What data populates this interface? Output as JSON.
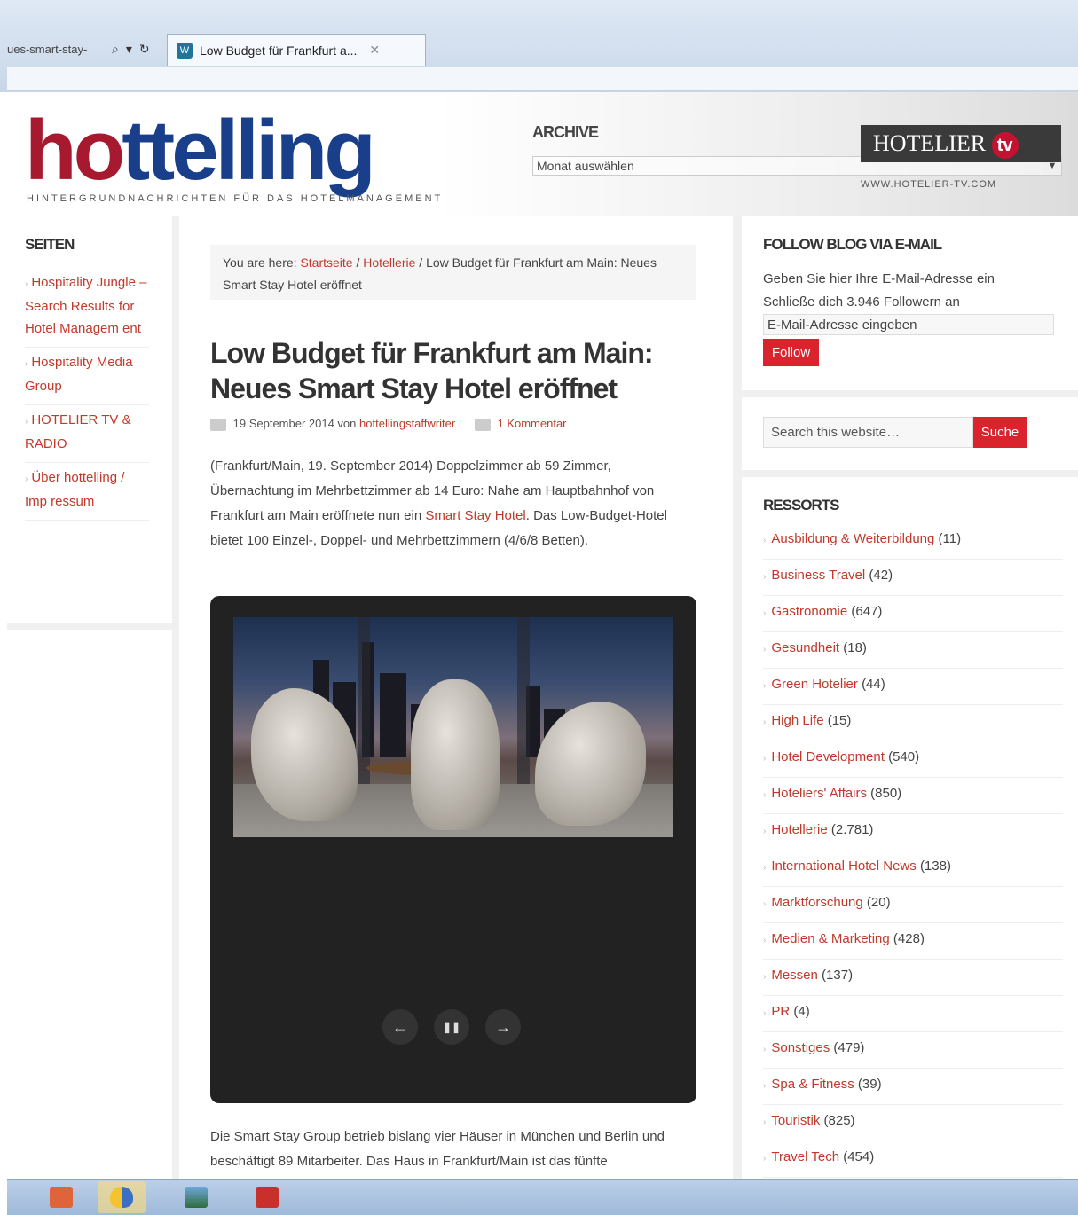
{
  "browser": {
    "address_fragment": "ues-smart-stay-",
    "tab_title": "Low Budget für Frankfurt a...",
    "favicon": "W"
  },
  "header": {
    "logo_part1": "ho",
    "logo_part2": "ttelling",
    "tagline": "HINTERGRUNDNACHRICHTEN FÜR DAS HOTELMANAGEMENT",
    "archive_label": "ARCHIVE",
    "archive_select_placeholder": "Monat auswählen",
    "ad_title": "HOTELIER",
    "ad_tv": "tv",
    "ad_url": "WWW.HOTELIER-TV.COM"
  },
  "left_sidebar": {
    "title": "SEITEN",
    "pages": [
      "Hospitality Jungle – Search Results for Hotel Managem ent",
      "Hospitality Media Group",
      "HOTELIER TV & RADIO",
      "Über hottelling / Imp ressum"
    ]
  },
  "content": {
    "breadcrumb_prefix": "You are here:",
    "crumb_home": "Startseite",
    "crumb_sep": "/",
    "crumb_category": "Hotellerie",
    "crumb_current": "/ Low Budget für Frankfurt am Main: Neues Smart Stay Hotel eröffnet",
    "title": "Low Budget für Frankfurt am Main: Neues Smart Stay Hotel eröffnet",
    "date": "19 September 2014 von",
    "author": "hottellingstaffwriter",
    "comments": "1 Kommentar",
    "intro_before": "(Frankfurt/Main, 19. September 2014) Doppelzimmer ab 59 Zimmer, Übernachtung im Mehrbettzimmer ab 14 Euro: Nahe am Hauptbahnhof von Frankfurt am Main eröffnete nun ein",
    "intro_link": "Smart Stay Hotel",
    "intro_after": ". Das Low-Budget-Hotel bietet 100 Einzel-, Doppel- und Mehrbettzimmern (4/6/8 Betten).",
    "slider_prev": "←",
    "slider_pause": "❚❚",
    "slider_next": "→",
    "para2": "Die Smart Stay Group betrieb bislang vier Häuser in München und Berlin und beschäftigt 89 Mitarbeiter. Das Haus in Frankfurt/Main ist das fünfte"
  },
  "right_sidebar": {
    "follow_title": "FOLLOW BLOG VIA E-MAIL",
    "follow_text": "Geben Sie hier Ihre E-Mail-Adresse ein Schließe dich 3.946 Followern an",
    "email_placeholder": "E-Mail-Adresse eingeben",
    "follow_button": "Follow",
    "search_placeholder": "Search this website…",
    "search_button": "Suche",
    "ressorts_title": "RESSORTS",
    "ressorts": [
      {
        "name": "Ausbildung & Weiterbildung",
        "count": "(11)"
      },
      {
        "name": "Business Travel",
        "count": "(42)"
      },
      {
        "name": "Gastronomie",
        "count": "(647)"
      },
      {
        "name": "Gesundheit",
        "count": "(18)"
      },
      {
        "name": "Green Hotelier",
        "count": "(44)"
      },
      {
        "name": "High Life",
        "count": "(15)"
      },
      {
        "name": "Hotel Development",
        "count": "(540)"
      },
      {
        "name": "Hoteliers' Affairs",
        "count": "(850)"
      },
      {
        "name": "Hotellerie",
        "count": "(2.781)"
      },
      {
        "name": "International Hotel News",
        "count": "(138)"
      },
      {
        "name": "Marktforschung",
        "count": "(20)"
      },
      {
        "name": "Medien & Marketing",
        "count": "(428)"
      },
      {
        "name": "Messen",
        "count": "(137)"
      },
      {
        "name": "PR",
        "count": "(4)"
      },
      {
        "name": "Sonstiges",
        "count": "(479)"
      },
      {
        "name": "Spa & Fitness",
        "count": "(39)"
      },
      {
        "name": "Touristik",
        "count": "(825)"
      },
      {
        "name": "Travel Tech",
        "count": "(454)"
      }
    ]
  },
  "taskbar": {
    "apps": [
      "office-app-icon",
      "security-shield-icon",
      "photo-viewer-icon",
      "presentation-app-icon"
    ]
  },
  "colors": {
    "accent_red": "#c0392b",
    "button_red": "#d9232d",
    "logo_red": "#a6192e",
    "logo_blue": "#1a3f8a"
  }
}
